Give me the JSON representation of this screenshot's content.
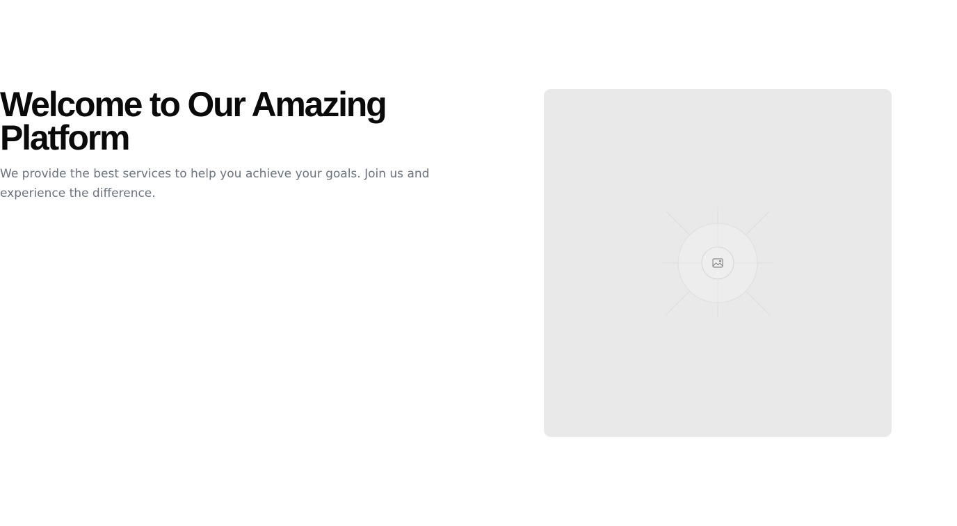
{
  "hero": {
    "title": "Welcome to Our Amazing Platform",
    "subtitle": "We provide the best services to help you achieve your goals. Join us and experience the difference."
  },
  "media": {
    "icon": "image-placeholder-icon",
    "colors": {
      "card_background": "#e9e9e9",
      "ring_fill": "#ededed",
      "ring_stroke": "#dcdcdc",
      "icon_stroke": "#8a8a8a"
    }
  },
  "colors": {
    "title": "#0a0a0a",
    "subtitle": "#6b7280",
    "page_background": "#ffffff"
  }
}
